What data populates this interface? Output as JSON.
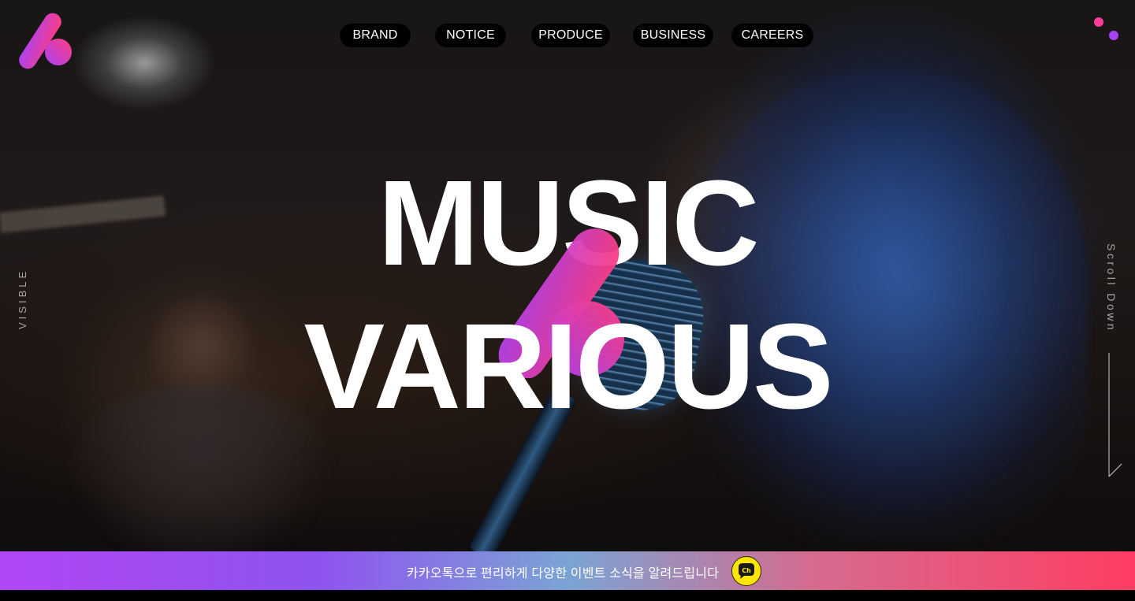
{
  "brand": {
    "logo_icon": "brand-logo-a-icon",
    "gradient_start": "#ff3d7f",
    "gradient_end": "#a842f5"
  },
  "nav": {
    "items": [
      {
        "label": "BRAND"
      },
      {
        "label": "NOTICE"
      },
      {
        "label": "PRODUCE"
      },
      {
        "label": "BUSINESS"
      },
      {
        "label": "CAREERS"
      }
    ]
  },
  "menu_toggle": {
    "icon": "two-dot-menu-icon",
    "colors": [
      "#ff3d9a",
      "#a842f5"
    ]
  },
  "hero": {
    "headline_line1": "MUSIC",
    "headline_line2": "VARIOUS",
    "side_left": "VISIBLE",
    "side_right": "Scroll Down",
    "scroll_icon": "scroll-down-arrow-icon"
  },
  "banner": {
    "text": "카카오톡으로 편리하게 다양한 이벤트 소식을 알려드립니다",
    "icon": "kakao-channel-icon",
    "icon_label": "Ch",
    "icon_color": "#ffe600"
  }
}
